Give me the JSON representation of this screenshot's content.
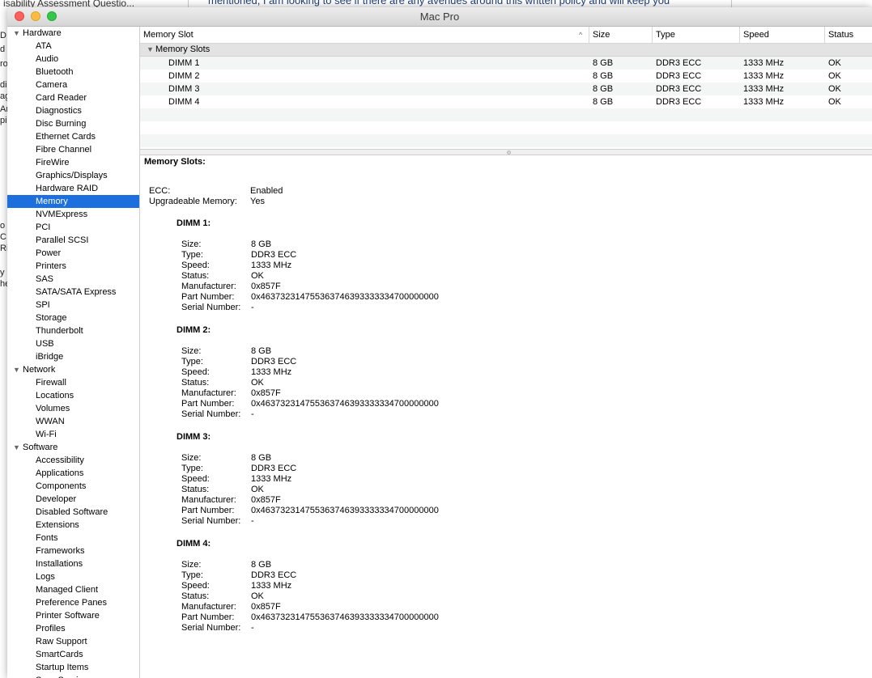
{
  "background": {
    "title_fragment": "isability Assessment Questio...",
    "text_fragment": "mentioned, I am looking to see if there are any avenues around this written policy and will keep you",
    "edge_chars": [
      "D",
      "d",
      "ro",
      "",
      "dig",
      "ag",
      "Ar",
      "pi",
      "",
      "o v",
      "C",
      "Ri",
      "",
      "y",
      "he"
    ]
  },
  "window": {
    "title": "Mac Pro"
  },
  "sidebar": {
    "categories": [
      {
        "label": "Hardware",
        "items": [
          "ATA",
          "Audio",
          "Bluetooth",
          "Camera",
          "Card Reader",
          "Diagnostics",
          "Disc Burning",
          "Ethernet Cards",
          "Fibre Channel",
          "FireWire",
          "Graphics/Displays",
          "Hardware RAID",
          "Memory",
          "NVMExpress",
          "PCI",
          "Parallel SCSI",
          "Power",
          "Printers",
          "SAS",
          "SATA/SATA Express",
          "SPI",
          "Storage",
          "Thunderbolt",
          "USB",
          "iBridge"
        ]
      },
      {
        "label": "Network",
        "items": [
          "Firewall",
          "Locations",
          "Volumes",
          "WWAN",
          "Wi-Fi"
        ]
      },
      {
        "label": "Software",
        "items": [
          "Accessibility",
          "Applications",
          "Components",
          "Developer",
          "Disabled Software",
          "Extensions",
          "Fonts",
          "Frameworks",
          "Installations",
          "Logs",
          "Managed Client",
          "Preference Panes",
          "Printer Software",
          "Profiles",
          "Raw Support",
          "SmartCards",
          "Startup Items",
          "Sync Services"
        ]
      }
    ],
    "selected": "Memory"
  },
  "table": {
    "columns": {
      "slot": "Memory Slot",
      "size": "Size",
      "type": "Type",
      "speed": "Speed",
      "status": "Status"
    },
    "group_label": "Memory Slots",
    "rows": [
      {
        "slot": "DIMM 1",
        "size": "8 GB",
        "type": "DDR3 ECC",
        "speed": "1333 MHz",
        "status": "OK"
      },
      {
        "slot": "DIMM 2",
        "size": "8 GB",
        "type": "DDR3 ECC",
        "speed": "1333 MHz",
        "status": "OK"
      },
      {
        "slot": "DIMM 3",
        "size": "8 GB",
        "type": "DDR3 ECC",
        "speed": "1333 MHz",
        "status": "OK"
      },
      {
        "slot": "DIMM 4",
        "size": "8 GB",
        "type": "DDR3 ECC",
        "speed": "1333 MHz",
        "status": "OK"
      }
    ]
  },
  "detail": {
    "title": "Memory Slots:",
    "summary": [
      {
        "key": "ECC:",
        "value": "Enabled"
      },
      {
        "key": "Upgradeable Memory:",
        "value": "Yes"
      }
    ],
    "dimms": [
      {
        "heading": "DIMM 1:",
        "fields": [
          {
            "key": "Size:",
            "value": "8 GB"
          },
          {
            "key": "Type:",
            "value": "DDR3 ECC"
          },
          {
            "key": "Speed:",
            "value": "1333 MHz"
          },
          {
            "key": "Status:",
            "value": "OK"
          },
          {
            "key": "Manufacturer:",
            "value": "0x857F"
          },
          {
            "key": "Part Number:",
            "value": "0x463732314755363746393333334700000000"
          },
          {
            "key": "Serial Number:",
            "value": "-"
          }
        ]
      },
      {
        "heading": "DIMM 2:",
        "fields": [
          {
            "key": "Size:",
            "value": "8 GB"
          },
          {
            "key": "Type:",
            "value": "DDR3 ECC"
          },
          {
            "key": "Speed:",
            "value": "1333 MHz"
          },
          {
            "key": "Status:",
            "value": "OK"
          },
          {
            "key": "Manufacturer:",
            "value": "0x857F"
          },
          {
            "key": "Part Number:",
            "value": "0x463732314755363746393333334700000000"
          },
          {
            "key": "Serial Number:",
            "value": "-"
          }
        ]
      },
      {
        "heading": "DIMM 3:",
        "fields": [
          {
            "key": "Size:",
            "value": "8 GB"
          },
          {
            "key": "Type:",
            "value": "DDR3 ECC"
          },
          {
            "key": "Speed:",
            "value": "1333 MHz"
          },
          {
            "key": "Status:",
            "value": "OK"
          },
          {
            "key": "Manufacturer:",
            "value": "0x857F"
          },
          {
            "key": "Part Number:",
            "value": "0x463732314755363746393333334700000000"
          },
          {
            "key": "Serial Number:",
            "value": "-"
          }
        ]
      },
      {
        "heading": "DIMM 4:",
        "fields": [
          {
            "key": "Size:",
            "value": "8 GB"
          },
          {
            "key": "Type:",
            "value": "DDR3 ECC"
          },
          {
            "key": "Speed:",
            "value": "1333 MHz"
          },
          {
            "key": "Status:",
            "value": "OK"
          },
          {
            "key": "Manufacturer:",
            "value": "0x857F"
          },
          {
            "key": "Part Number:",
            "value": "0x463732314755363746393333334700000000"
          },
          {
            "key": "Serial Number:",
            "value": "-"
          }
        ]
      }
    ]
  },
  "icons": {
    "disclosure": "disclosure-triangle-icon",
    "sort": "sort-ascending-icon"
  },
  "colors": {
    "selection": "#1d6fde",
    "close": "#fc605c",
    "minimize": "#fdbc40",
    "zoom": "#34c84a"
  }
}
